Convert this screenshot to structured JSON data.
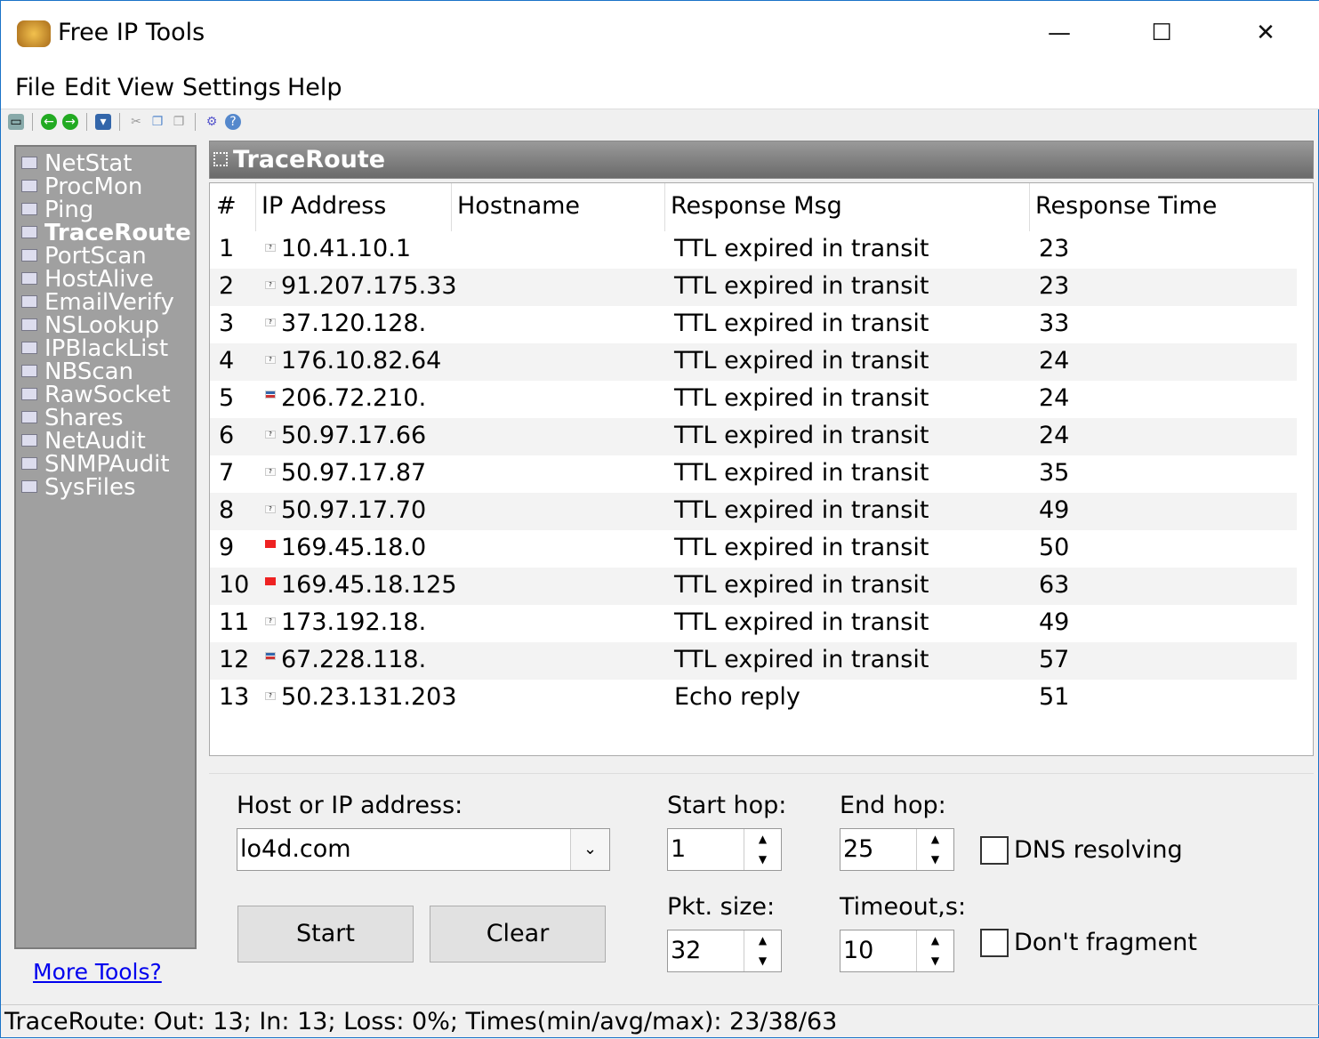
{
  "window": {
    "title": "Free IP Tools",
    "minimize": "—",
    "maximize": "☐",
    "close": "✕"
  },
  "menu": [
    "File",
    "Edit",
    "View",
    "Settings",
    "Help"
  ],
  "toolbar": [
    "computer-icon",
    "back-icon",
    "forward-icon",
    "save-icon",
    "cut-icon",
    "copy-icon",
    "paste-icon",
    "settings-icon",
    "help-icon"
  ],
  "sidebar": {
    "items": [
      "NetStat",
      "ProcMon",
      "Ping",
      "TraceRoute",
      "PortScan",
      "HostAlive",
      "EmailVerify",
      "NSLookup",
      "IPBlackList",
      "NBScan",
      "RawSocket",
      "Shares",
      "NetAudit",
      "SNMPAudit",
      "SysFiles"
    ],
    "active": "TraceRoute",
    "more": "More Tools?"
  },
  "panel": {
    "title": "TraceRoute"
  },
  "table": {
    "headers": [
      "#",
      "IP Address",
      "Hostname",
      "Response Msg",
      "Response Time"
    ],
    "rows": [
      [
        "1",
        "10.41.10.1",
        "",
        "TTL expired in transit",
        "23"
      ],
      [
        "2",
        "91.207.175.33",
        "",
        "TTL expired in transit",
        "23"
      ],
      [
        "3",
        "37.120.128.",
        "",
        "TTL expired in transit",
        "33"
      ],
      [
        "4",
        "176.10.82.64",
        "",
        "TTL expired in transit",
        "24"
      ],
      [
        "5",
        "206.72.210.",
        "",
        "TTL expired in transit",
        "24"
      ],
      [
        "6",
        "50.97.17.66",
        "",
        "TTL expired in transit",
        "24"
      ],
      [
        "7",
        "50.97.17.87",
        "",
        "TTL expired in transit",
        "35"
      ],
      [
        "8",
        "50.97.17.70",
        "",
        "TTL expired in transit",
        "49"
      ],
      [
        "9",
        "169.45.18.0",
        "",
        "TTL expired in transit",
        "50"
      ],
      [
        "10",
        "169.45.18.125",
        "",
        "TTL expired in transit",
        "63"
      ],
      [
        "11",
        "173.192.18.",
        "",
        "TTL expired in transit",
        "49"
      ],
      [
        "12",
        "67.228.118.",
        "",
        "TTL expired in transit",
        "57"
      ],
      [
        "13",
        "50.23.131.203",
        "",
        "Echo reply",
        "51"
      ]
    ],
    "flags": [
      "unknown",
      "unknown",
      "unknown",
      "unknown",
      "us",
      "unknown",
      "unknown",
      "unknown",
      "ch",
      "ch",
      "unknown",
      "us",
      "unknown"
    ]
  },
  "form": {
    "host_label": "Host or IP address:",
    "host_value": "lo4d.com",
    "start_hop_label": "Start hop:",
    "start_hop": "1",
    "end_hop_label": "End hop:",
    "end_hop": "25",
    "pkt_label": "Pkt. size:",
    "pkt": "32",
    "timeout_label": "Timeout,s:",
    "timeout": "10",
    "dns_label": "DNS resolving",
    "frag_label": "Don't fragment",
    "start": "Start",
    "clear": "Clear"
  },
  "status": "TraceRoute: Out: 13; In: 13; Loss: 0%; Times(min/avg/max): 23/38/63"
}
